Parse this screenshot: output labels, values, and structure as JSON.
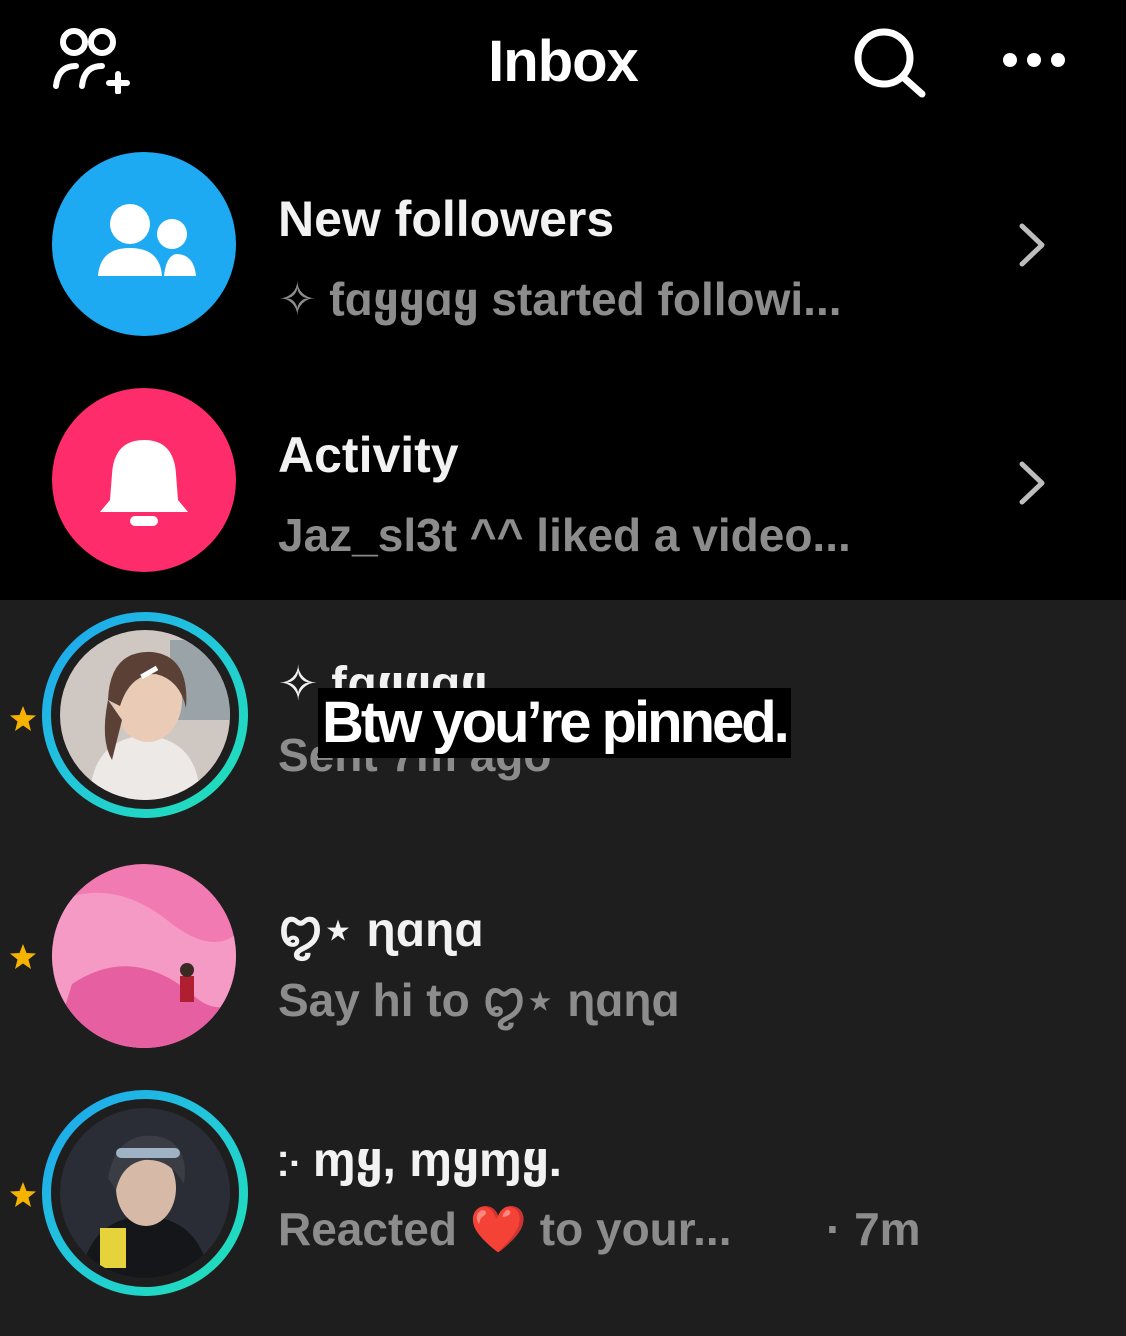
{
  "header": {
    "title": "Inbox",
    "icons": {
      "left": "add-friends-icon",
      "search": "search-icon",
      "more": "more-icon"
    }
  },
  "system_rows": [
    {
      "title": "New followers",
      "subtitle": "✧ ƭɑყყɑყ started followi...",
      "icon": "people-icon",
      "color": "#1daaf2"
    },
    {
      "title": "Activity",
      "subtitle": "Jaz_sl3t ^^ liked a video...",
      "icon": "bell-icon",
      "color": "#fe2c6a"
    }
  ],
  "chats": [
    {
      "name": "✧ ƭɑყყɑყ",
      "subtitle": "Sent 7m ago",
      "pinned": true,
      "has_story_ring": true
    },
    {
      "name": "ꨄ⋆ ɳɑɳɑ",
      "subtitle": "Say hi to ꨄ⋆ ɳɑɳɑ",
      "pinned": true,
      "has_story_ring": false
    },
    {
      "name": "჻ ɱყ, ɱყɱყ.",
      "subtitle": "Reacted ❤️ to your...",
      "time": "· 7m",
      "pinned": true,
      "has_story_ring": true
    }
  ],
  "overlay_caption": "Btw you’re pinned.",
  "colors": {
    "background_top": "#000000",
    "background_chats": "#1e1e1e",
    "followers_accent": "#1daaf2",
    "activity_accent": "#fe2c6a",
    "pin_star": "#f5b300",
    "story_ring": "#22c9d8"
  }
}
